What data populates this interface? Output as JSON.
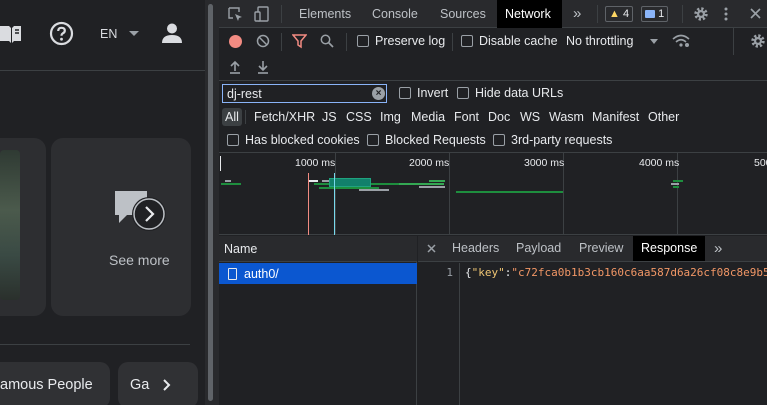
{
  "app": {
    "language": "EN",
    "see_more": "See more",
    "chips": [
      "amous People",
      "Ga"
    ]
  },
  "devtools": {
    "tabs": [
      "Elements",
      "Console",
      "Sources",
      "Network"
    ],
    "active_tab": "Network",
    "more_tabs": "»",
    "warning_count": "4",
    "message_count": "1",
    "toolbar": {
      "preserve_log": "Preserve log",
      "disable_cache": "Disable cache",
      "throttling": "No throttling"
    },
    "filter": {
      "value": "dj-rest",
      "invert": "Invert",
      "hide_data_urls": "Hide data URLs"
    },
    "types": [
      "All",
      "Fetch/XHR",
      "JS",
      "CSS",
      "Img",
      "Media",
      "Font",
      "Doc",
      "WS",
      "Wasm",
      "Manifest",
      "Other"
    ],
    "blocked": {
      "has_blocked_cookies": "Has blocked cookies",
      "blocked_requests": "Blocked Requests",
      "third_party": "3rd-party requests"
    },
    "timeline_ticks": [
      "1000 ms",
      "2000 ms",
      "3000 ms",
      "4000 ms",
      "500"
    ],
    "requests": {
      "name_header": "Name",
      "items": [
        "auth0/"
      ]
    },
    "detail_tabs": [
      "Headers",
      "Payload",
      "Preview",
      "Response"
    ],
    "active_detail_tab": "Response",
    "response": {
      "line_number": "1",
      "open_brace": "{",
      "key": "\"key\"",
      "colon": ":",
      "value": "\"c72fca0b1b3cb160c6aa587d6a26cf08c8e9b5"
    }
  }
}
